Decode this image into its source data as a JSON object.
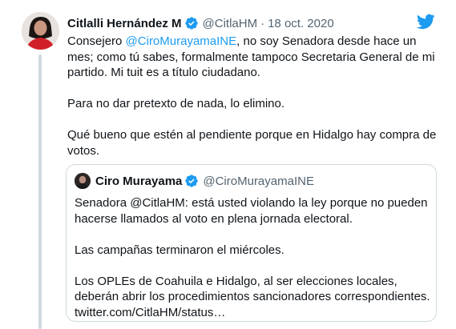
{
  "tweet": {
    "author_name": "Citlalli Hernández M",
    "author_handle": "@CitlaHM",
    "separator": "·",
    "date": "18 oct. 2020",
    "body": {
      "p1_prefix": "Consejero ",
      "p1_mention": "@CiroMurayamaINE",
      "p1_rest": ", no soy Senadora desde hace un mes; como tú sabes, formalmente tampoco Secretaria General de mi partido. Mi tuit es a título ciudadano.",
      "p2": "Para no dar pretexto de nada, lo elimino.",
      "p3": "Qué bueno que estén al pendiente porque en Hidalgo hay compra de votos."
    }
  },
  "quoted": {
    "author_name": "Ciro Murayama",
    "author_handle": "@CiroMurayamaINE",
    "body": {
      "p1": "Senadora @CitlaHM: está usted violando la ley porque no pueden hacerse llamados al voto en plena jornada electoral.",
      "p2": "Las campañas terminaron el miércoles.",
      "p3_text": "Los OPLEs de Coahuila e Hidalgo, al ser elecciones locales, deberán abrir los procedimientos sancionadores correspondientes.",
      "p3_link": "twitter.com/CitlaHM/status…"
    }
  },
  "colors": {
    "brand_blue": "#1d9bf0",
    "text_primary": "#0f1419",
    "text_secondary": "#536471",
    "border": "#cfd9de"
  },
  "icons": {
    "verified": "verified-badge-icon",
    "brand": "twitter-bird-icon"
  }
}
